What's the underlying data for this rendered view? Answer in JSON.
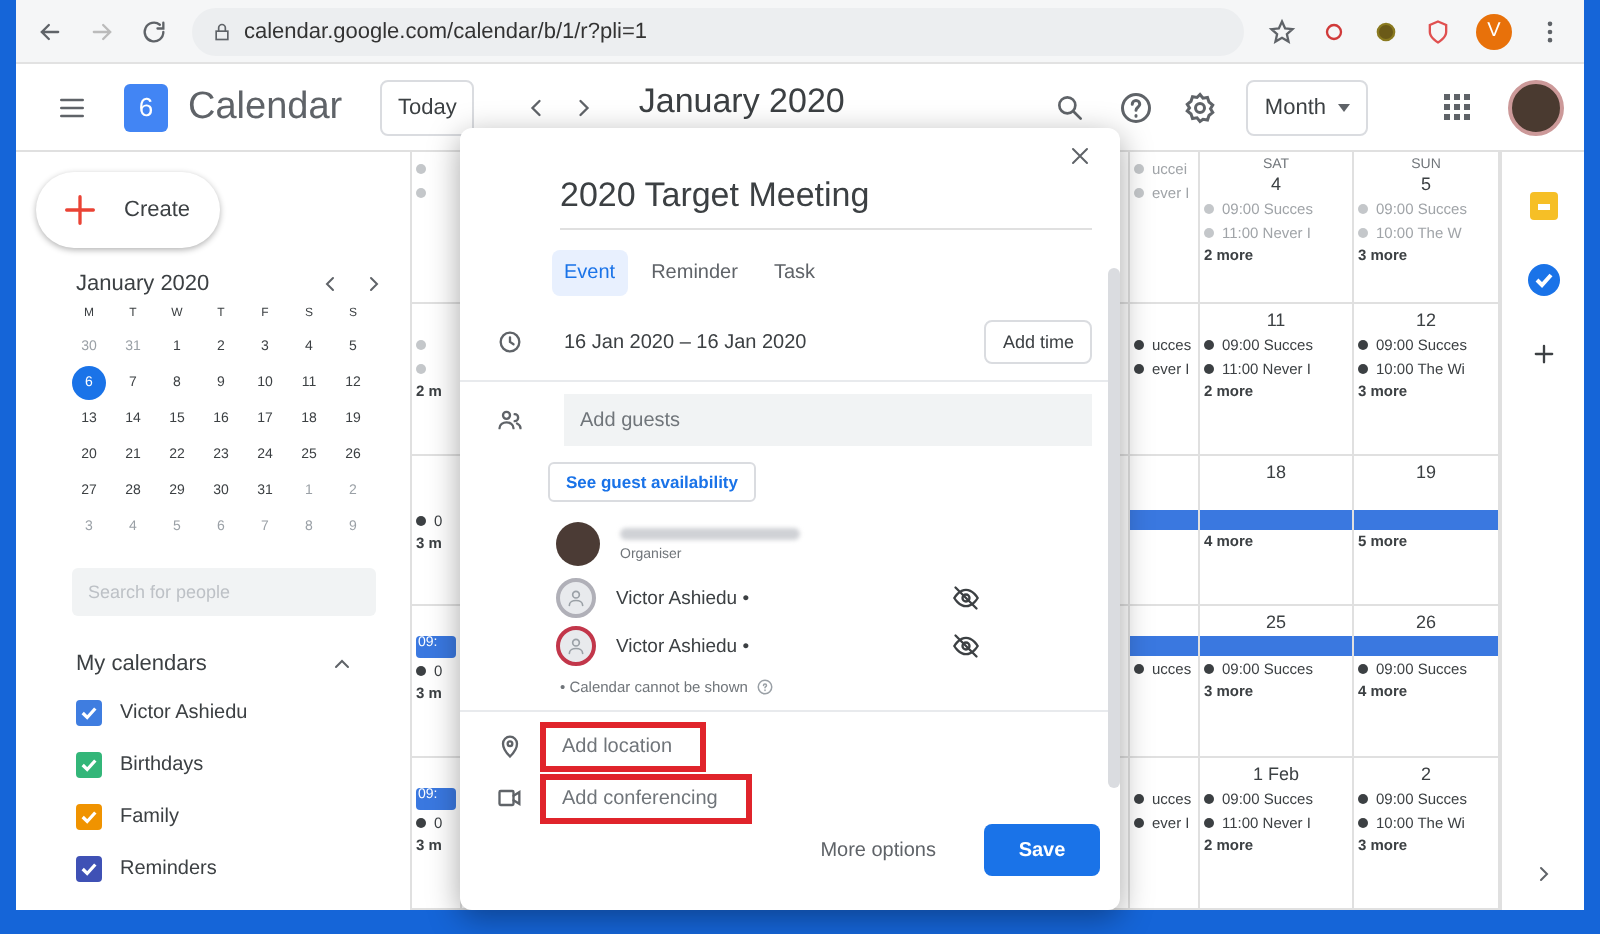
{
  "browser": {
    "url": "calendar.google.com/calendar/b/1/r?pli=1",
    "profile_initial": "V"
  },
  "header": {
    "logo_day": "6",
    "app_name": "Calendar",
    "today_button": "Today",
    "period": "January 2020",
    "view_button": "Month"
  },
  "sidebar": {
    "create_button": "Create",
    "mini_calendar": {
      "title": "January 2020",
      "weekdays": [
        "M",
        "T",
        "W",
        "T",
        "F",
        "S",
        "S"
      ],
      "weeks": [
        [
          {
            "day": "30",
            "other_month": true,
            "selected": false
          },
          {
            "day": "31",
            "other_month": true,
            "selected": false
          },
          {
            "day": "1",
            "other_month": false,
            "selected": false
          },
          {
            "day": "2",
            "other_month": false,
            "selected": false
          },
          {
            "day": "3",
            "other_month": false,
            "selected": false
          },
          {
            "day": "4",
            "other_month": false,
            "selected": false
          },
          {
            "day": "5",
            "other_month": false,
            "selected": false
          }
        ],
        [
          {
            "day": "6",
            "other_month": false,
            "selected": true
          },
          {
            "day": "7",
            "other_month": false,
            "selected": false
          },
          {
            "day": "8",
            "other_month": false,
            "selected": false
          },
          {
            "day": "9",
            "other_month": false,
            "selected": false
          },
          {
            "day": "10",
            "other_month": false,
            "selected": false
          },
          {
            "day": "11",
            "other_month": false,
            "selected": false
          },
          {
            "day": "12",
            "other_month": false,
            "selected": false
          }
        ],
        [
          {
            "day": "13",
            "other_month": false,
            "selected": false
          },
          {
            "day": "14",
            "other_month": false,
            "selected": false
          },
          {
            "day": "15",
            "other_month": false,
            "selected": false
          },
          {
            "day": "16",
            "other_month": false,
            "selected": false
          },
          {
            "day": "17",
            "other_month": false,
            "selected": false
          },
          {
            "day": "18",
            "other_month": false,
            "selected": false
          },
          {
            "day": "19",
            "other_month": false,
            "selected": false
          }
        ],
        [
          {
            "day": "20",
            "other_month": false,
            "selected": false
          },
          {
            "day": "21",
            "other_month": false,
            "selected": false
          },
          {
            "day": "22",
            "other_month": false,
            "selected": false
          },
          {
            "day": "23",
            "other_month": false,
            "selected": false
          },
          {
            "day": "24",
            "other_month": false,
            "selected": false
          },
          {
            "day": "25",
            "other_month": false,
            "selected": false
          },
          {
            "day": "26",
            "other_month": false,
            "selected": false
          }
        ],
        [
          {
            "day": "27",
            "other_month": false,
            "selected": false
          },
          {
            "day": "28",
            "other_month": false,
            "selected": false
          },
          {
            "day": "29",
            "other_month": false,
            "selected": false
          },
          {
            "day": "30",
            "other_month": false,
            "selected": false
          },
          {
            "day": "31",
            "other_month": false,
            "selected": false
          },
          {
            "day": "1",
            "other_month": true,
            "selected": false
          },
          {
            "day": "2",
            "other_month": true,
            "selected": false
          }
        ],
        [
          {
            "day": "3",
            "other_month": true,
            "selected": false
          },
          {
            "day": "4",
            "other_month": true,
            "selected": false
          },
          {
            "day": "5",
            "other_month": true,
            "selected": false
          },
          {
            "day": "6",
            "other_month": true,
            "selected": false
          },
          {
            "day": "7",
            "other_month": true,
            "selected": false
          },
          {
            "day": "8",
            "other_month": true,
            "selected": false
          },
          {
            "day": "9",
            "other_month": true,
            "selected": false
          }
        ]
      ]
    },
    "search": {
      "placeholder": "Search for people"
    },
    "my_calendars": {
      "title": "My calendars",
      "expanded": true,
      "items": [
        {
          "name": "Victor Ashiedu",
          "checked": true,
          "color": "#3f7de0"
        },
        {
          "name": "Birthdays",
          "checked": true,
          "color": "#33b679"
        },
        {
          "name": "Family",
          "checked": true,
          "color": "#f09300"
        },
        {
          "name": "Reminders",
          "checked": true,
          "color": "#3f51b5"
        }
      ]
    }
  },
  "month_grid": {
    "weeks": [
      {
        "cells": [
          {
            "items": [
              {
                "kind": "dot",
                "past": true
              },
              {
                "kind": "dot",
                "past": true
              }
            ]
          },
          {
            "items": [
              {
                "kind": "event",
                "text": "uccei",
                "past": true
              },
              {
                "kind": "event",
                "text": "ever I",
                "past": true
              }
            ]
          },
          {
            "heading": "SAT",
            "date": "4",
            "items": [
              {
                "kind": "event",
                "text": "09:00 Succes",
                "past": true
              },
              {
                "kind": "event",
                "text": "11:00 Never I",
                "past": true
              },
              {
                "kind": "more",
                "text": "2 more"
              }
            ]
          },
          {
            "heading": "SUN",
            "date": "5",
            "items": [
              {
                "kind": "event",
                "text": "09:00 Succes",
                "past": true
              },
              {
                "kind": "event",
                "text": "10:00 The W",
                "past": true
              },
              {
                "kind": "more",
                "text": "3 more"
              }
            ]
          }
        ]
      },
      {
        "cells": [
          {
            "items": [
              {
                "kind": "blank"
              },
              {
                "kind": "dot",
                "past": true
              },
              {
                "kind": "dot",
                "past": true
              },
              {
                "kind": "more",
                "text": "2 m"
              }
            ]
          },
          {
            "items": [
              {
                "kind": "blank"
              },
              {
                "kind": "event",
                "text": "ucces",
                "past": false
              },
              {
                "kind": "event",
                "text": "ever I",
                "past": false
              }
            ]
          },
          {
            "date": "11",
            "items": [
              {
                "kind": "event",
                "text": "09:00 Succes",
                "past": false
              },
              {
                "kind": "event",
                "text": "11:00 Never I",
                "past": false
              },
              {
                "kind": "more",
                "text": "2 more"
              }
            ]
          },
          {
            "date": "12",
            "items": [
              {
                "kind": "event",
                "text": "09:00 Succes",
                "past": false
              },
              {
                "kind": "event",
                "text": "10:00 The Wi",
                "past": false
              },
              {
                "kind": "more",
                "text": "3 more"
              }
            ]
          }
        ]
      },
      {
        "cells": [
          {
            "items": [
              {
                "kind": "blank"
              },
              {
                "kind": "blank"
              },
              {
                "kind": "event",
                "text": "0",
                "past": false
              },
              {
                "kind": "more",
                "text": "3 m"
              }
            ]
          },
          {
            "items": [
              {
                "kind": "blank"
              },
              {
                "kind": "blank"
              },
              {
                "kind": "bar"
              }
            ]
          },
          {
            "date": "18",
            "items": [
              {
                "kind": "blank"
              },
              {
                "kind": "bar"
              },
              {
                "kind": "more",
                "text": "4 more"
              }
            ]
          },
          {
            "date": "19",
            "items": [
              {
                "kind": "blank"
              },
              {
                "kind": "bar"
              },
              {
                "kind": "more",
                "text": "5 more"
              }
            ]
          }
        ]
      },
      {
        "cells": [
          {
            "items": [
              {
                "kind": "blank"
              },
              {
                "kind": "chip",
                "text": "09:"
              },
              {
                "kind": "event",
                "text": "0",
                "past": false
              },
              {
                "kind": "more",
                "text": "3 m"
              }
            ]
          },
          {
            "items": [
              {
                "kind": "blank"
              },
              {
                "kind": "bar"
              },
              {
                "kind": "event",
                "text": "ucces",
                "past": false
              }
            ]
          },
          {
            "date": "25",
            "items": [
              {
                "kind": "bar"
              },
              {
                "kind": "event",
                "text": "09:00 Succes",
                "past": false
              },
              {
                "kind": "more",
                "text": "3 more"
              }
            ]
          },
          {
            "date": "26",
            "items": [
              {
                "kind": "bar"
              },
              {
                "kind": "event",
                "text": "09:00 Succes",
                "past": false
              },
              {
                "kind": "more",
                "text": "4 more"
              }
            ]
          }
        ]
      },
      {
        "cells": [
          {
            "items": [
              {
                "kind": "blank"
              },
              {
                "kind": "chip",
                "text": "09:"
              },
              {
                "kind": "event",
                "text": "0",
                "past": false
              },
              {
                "kind": "more",
                "text": "3 m"
              }
            ]
          },
          {
            "items": [
              {
                "kind": "blank"
              },
              {
                "kind": "event",
                "text": "ucces",
                "past": false
              },
              {
                "kind": "event",
                "text": "ever I",
                "past": false
              }
            ]
          },
          {
            "date": "1 Feb",
            "items": [
              {
                "kind": "event",
                "text": "09:00 Succes",
                "past": false
              },
              {
                "kind": "event",
                "text": "11:00 Never I",
                "past": false
              },
              {
                "kind": "more",
                "text": "2 more"
              }
            ]
          },
          {
            "date": "2",
            "items": [
              {
                "kind": "event",
                "text": "09:00 Succes",
                "past": false
              },
              {
                "kind": "event",
                "text": "10:00 The Wi",
                "past": false
              },
              {
                "kind": "more",
                "text": "3 more"
              }
            ]
          }
        ]
      }
    ]
  },
  "dialog": {
    "title": "2020 Target Meeting",
    "tabs": [
      {
        "label": "Event",
        "selected": true
      },
      {
        "label": "Reminder",
        "selected": false
      },
      {
        "label": "Task",
        "selected": false
      }
    ],
    "date_range": "16 Jan 2020  –  16 Jan 2020",
    "add_time_button": "Add time",
    "guests_field": {
      "placeholder": "Add guests"
    },
    "availability_button": "See guest availability",
    "organiser": {
      "role": "Organiser"
    },
    "guests": [
      {
        "name": "Victor Ashiedu •",
        "color": "#b0b0b8"
      },
      {
        "name": "Victor Ashiedu •",
        "color": "#c2364a"
      }
    ],
    "calendar_note": "• Calendar cannot be shown",
    "options": [
      {
        "kind": "location",
        "label": "Add location",
        "highlighted": true
      },
      {
        "kind": "conferencing",
        "label": "Add conferencing",
        "highlighted": true
      }
    ],
    "more_options_button": "More options",
    "save_button": "Save"
  }
}
